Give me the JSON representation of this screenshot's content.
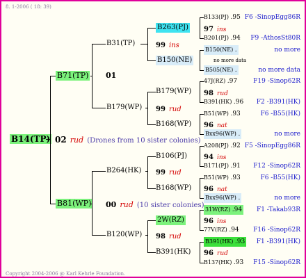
{
  "header": "8.  1-2006 ( 18: 39)",
  "copyright": "Copyright 2004-2006 @ Karl Kehrle Foundation.",
  "root": {
    "id": "B14(TP)"
  },
  "gen1": {
    "top": {
      "id": "B71(TP)"
    },
    "mid": {
      "num": "02",
      "tag": "rud",
      "note": "(Drones from 10 sister colonies)"
    },
    "bottom": {
      "id": "B81(WP)"
    }
  },
  "gen2": {
    "a": {
      "id": "B31(TP)"
    },
    "a_num": {
      "num": "01"
    },
    "b": {
      "id": "B179(WP)"
    },
    "c": {
      "id": "B264(HK)"
    },
    "c_num": {
      "num": "00",
      "tag": "rud",
      "note": "(10 sister colonies)"
    },
    "d": {
      "id": "B120(WP)"
    }
  },
  "gen3": [
    {
      "id": "B263(PJ)",
      "num": "99",
      "tag": "ins"
    },
    {
      "id": "B150(NE)"
    },
    {
      "id": "B179(WP)",
      "num": "99",
      "tag": "rud"
    },
    {
      "id": "B168(WP)"
    },
    {
      "id": "B106(PJ)",
      "num": "99",
      "tag": "rud"
    },
    {
      "id": "B168(WP)"
    },
    {
      "id": "2W(RZ)",
      "num": "98",
      "tag": "rud"
    },
    {
      "id": "B391(HK)"
    }
  ],
  "gen4": [
    {
      "id": "B133(PJ)",
      "sep": ".95",
      "info": "F6 -SinopEgg86R"
    },
    {
      "num": "97",
      "tag": "ins"
    },
    {
      "id": "B201(PJ)",
      "sep": ".94",
      "info": "F9 -AthosSt80R"
    },
    {
      "id": "B150(NE)",
      "sep": ".",
      "info": "no more"
    },
    {
      "info": "no more data"
    },
    {
      "id": "B505(NE)",
      "sep": ".",
      "info": "no more data"
    },
    {
      "id": "47J(RZ)",
      "sep": ".97",
      "info": "F19 -Sinop62R"
    },
    {
      "num": "98",
      "tag": "rud"
    },
    {
      "id": "B391(HK)",
      "sep": ".96",
      "info": "F2 -B391(HK)"
    },
    {
      "id": "B51(WP)",
      "sep": ".93",
      "info": "F6 -B55(HK)"
    },
    {
      "num": "96",
      "tag": "nat"
    },
    {
      "id": "Bxx96(WP)",
      "sep": ".",
      "info": "no more"
    },
    {
      "id": "A208(PJ)",
      "sep": ".92",
      "info": "F5 -SinopEgg86R"
    },
    {
      "num": "94",
      "tag": "ins"
    },
    {
      "id": "B171(PJ)",
      "sep": ".91",
      "info": "F12 -Sinop62R"
    },
    {
      "id": "B51(WP)",
      "sep": ".93",
      "info": "F6 -B55(HK)"
    },
    {
      "num": "96",
      "tag": "nat"
    },
    {
      "id": "Bxx96(WP)",
      "sep": ".",
      "info": "no more"
    },
    {
      "id": "31W(RZ)",
      "sep": ".94",
      "info": "F1 -Takab93R"
    },
    {
      "num": "96",
      "tag": "ins"
    },
    {
      "id": "77V(RZ)",
      "sep": ".94",
      "info": "F16 -Sinop62R"
    },
    {
      "id": "B391(HK)",
      "sep": ".93",
      "info": "F1 -B391(HK)"
    },
    {
      "num": "96",
      "tag": "rud"
    },
    {
      "id": "B137(HK)",
      "sep": ".93",
      "info": "F15 -Sinop62R"
    }
  ],
  "colors": {
    "border": "#e0009a",
    "green": "#7cf27c",
    "cyan": "#3fe3f0",
    "light_blue": "#d8ecf8",
    "dark_green": "#3be03b",
    "red": "#d40000",
    "blue": "#1a1acc"
  }
}
